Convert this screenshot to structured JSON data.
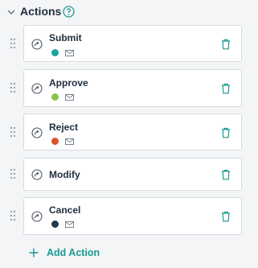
{
  "section": {
    "title": "Actions",
    "help_icon": "help-circle-icon",
    "collapse_icon": "chevron-down-icon"
  },
  "colors": {
    "accent": "#1b9a92",
    "submit": "#1ea39a",
    "approve": "#8bc34a",
    "reject": "#d9552b",
    "cancel": "#233447"
  },
  "actions": [
    {
      "label": "Submit",
      "status_color": "#1ea39a",
      "notify_icon": "mail-icon"
    },
    {
      "label": "Approve",
      "status_color": "#8bc34a",
      "notify_icon": "mail-icon"
    },
    {
      "label": "Reject",
      "status_color": "#d9552b",
      "notify_icon": "mail-icon"
    },
    {
      "label": "Modify"
    },
    {
      "label": "Cancel",
      "status_color": "#233447",
      "notify_icon": "mail-icon"
    }
  ],
  "add_button": {
    "label": "Add Action"
  }
}
